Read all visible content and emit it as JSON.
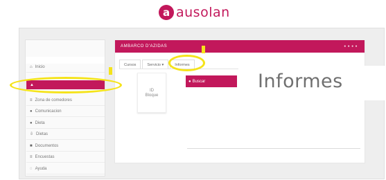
{
  "brand": {
    "mark": "a",
    "name": "ausolan"
  },
  "window": {
    "title": "AMBARCO D'AZIDAS",
    "header_right": "● ● ● ●"
  },
  "sidebar": {
    "items": [
      {
        "icon": "home-icon",
        "glyph": "⌂",
        "label": "Inicio"
      },
      {
        "icon": "chart-icon",
        "glyph": "▲",
        "label": ""
      },
      {
        "icon": "list-icon",
        "glyph": "≡",
        "label": "Zona de comedores"
      },
      {
        "icon": "users-icon",
        "glyph": "●",
        "label": "Comunicacion"
      },
      {
        "icon": "doc-icon",
        "glyph": "●",
        "label": "Dieta"
      },
      {
        "icon": "pdf-icon",
        "glyph": "⇩",
        "label": "Dietas"
      },
      {
        "icon": "file-icon",
        "glyph": "■",
        "label": "Documentos"
      },
      {
        "icon": "menu-icon",
        "glyph": "≡",
        "label": "Encuestas"
      },
      {
        "icon": "help-icon",
        "glyph": "◌",
        "label": "Ayuda"
      }
    ]
  },
  "tabs": [
    "Cursos",
    "Servicio ▾",
    "Informes"
  ],
  "card": {
    "line1": "ID",
    "line2": "Bloque"
  },
  "action_button": {
    "glyph": "●",
    "label": "Buscar"
  },
  "callout": {
    "text": "Informes"
  },
  "colors": {
    "accent": "#c2185b",
    "annotation": "#f5e31a"
  }
}
